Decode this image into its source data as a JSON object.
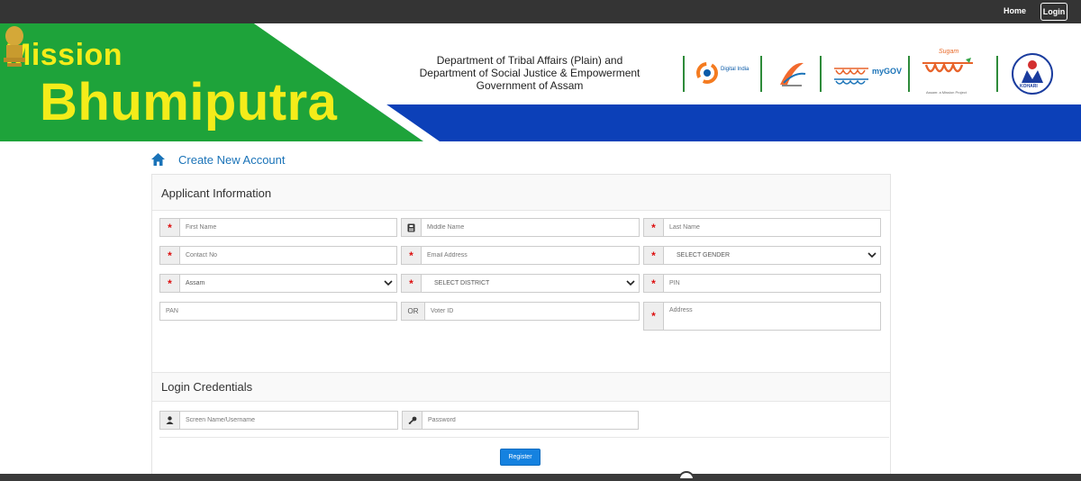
{
  "topbar": {
    "home_label": "Home",
    "login_label": "Login"
  },
  "banner": {
    "mission": "Mission",
    "bhumiputra": "Bhumiputra",
    "dept_line1": "Department of Tribal Affairs (Plain) and",
    "dept_line2": "Department of Social Justice & Empowerment",
    "dept_line3": "Government of Assam",
    "logo_digital_india": "Digital India",
    "logo_mygov": "myGOV",
    "logo_sugam": "Sugam",
    "logo_sugam_caption": "Assam: a Mission Project",
    "logo_kohari": "KOHARI"
  },
  "breadcrumb": {
    "title": "Create New Account"
  },
  "applicant": {
    "heading": "Applicant Information",
    "first_name": "First Name",
    "middle_name": "Middle Name",
    "last_name": "Last Name",
    "contact_no": "Contact No",
    "email": "Email Address",
    "gender": "SELECT GENDER",
    "state": "Assam",
    "district": "SELECT DISTRICT",
    "pin": "PIN",
    "pan": "PAN",
    "or_label": "OR",
    "voter_id": "Voter ID",
    "address": "Address"
  },
  "credentials": {
    "heading": "Login Credentials",
    "username": "Screen Name/Username",
    "password": "Password"
  },
  "register_label": "Register",
  "colors": {
    "banner_green": "#1ea33a",
    "banner_blue": "#0c40b8",
    "mission_yellow": "#f4ec1a",
    "link_blue": "#1a73b8",
    "button_blue": "#1582e0",
    "required_red": "#d11111"
  },
  "icons": [
    "home-icon",
    "asterisk-icon",
    "id-card-icon",
    "user-icon",
    "key-icon",
    "chevron-down-icon",
    "state-emblem-icon"
  ]
}
